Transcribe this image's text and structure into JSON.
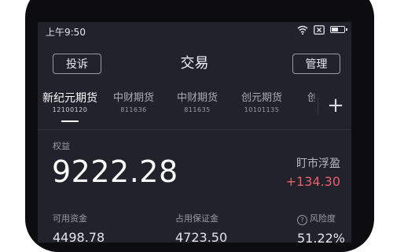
{
  "status_bar": {
    "time": "上午9:50",
    "battery_level": 0.55
  },
  "header": {
    "left_button": "投诉",
    "title": "交易",
    "right_button": "管理"
  },
  "tabs": [
    {
      "name": "新纪元期货",
      "code": "12100120",
      "active": true
    },
    {
      "name": "中财期货",
      "code": "811636"
    },
    {
      "name": "中财期货",
      "code": "811635"
    },
    {
      "name": "创元期货",
      "code": "10101135"
    },
    {
      "name": "创"
    }
  ],
  "tab_add_label": "+",
  "account": {
    "equity_label": "权益",
    "equity_value": "9222.28",
    "pnl_label": "盯市浮盈",
    "pnl_value": "+134.30",
    "available_label": "可用资金",
    "available_value": "4498.78",
    "margin_label": "占用保证金",
    "margin_value": "4723.50",
    "risk_label": "风险度",
    "risk_value": "51.22%"
  },
  "colors": {
    "background": "#22222d",
    "profit": "#e8606b",
    "text": "#ffffff"
  },
  "icons": [
    "wifi-icon",
    "sim-x-icon",
    "battery-icon",
    "plus-icon",
    "help-icon"
  ]
}
